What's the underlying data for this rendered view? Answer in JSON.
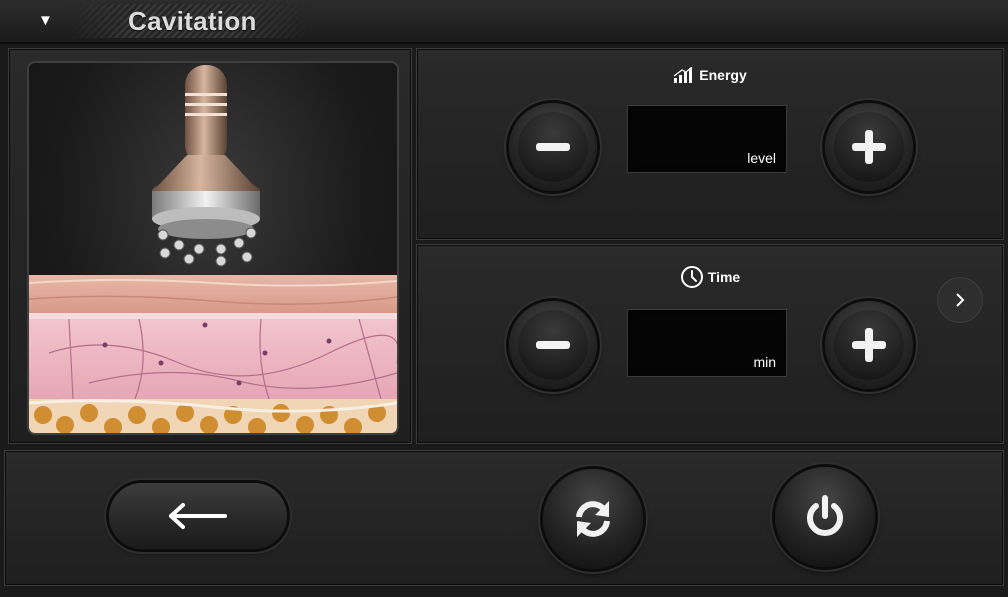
{
  "header": {
    "title": "Cavitation",
    "collapse_icon": "triangle-down-icon"
  },
  "illustration": {
    "description_icon": "cavitation-probe-over-skin-layers"
  },
  "energy": {
    "label": "Energy",
    "icon": "signal-bars-icon",
    "value": "",
    "unit": "level",
    "decrease_icon": "minus-icon",
    "increase_icon": "plus-icon"
  },
  "time": {
    "label": "Time",
    "icon": "clock-icon",
    "value": "",
    "unit": "min",
    "decrease_icon": "minus-icon",
    "increase_icon": "plus-icon",
    "next_icon": "chevron-right-icon"
  },
  "bottom": {
    "back_icon": "arrow-left-icon",
    "refresh_icon": "refresh-icon",
    "power_icon": "power-icon"
  },
  "colors": {
    "background": "#1a1a1a",
    "panel": "#262626",
    "display": "#050505",
    "text": "#ffffff"
  }
}
